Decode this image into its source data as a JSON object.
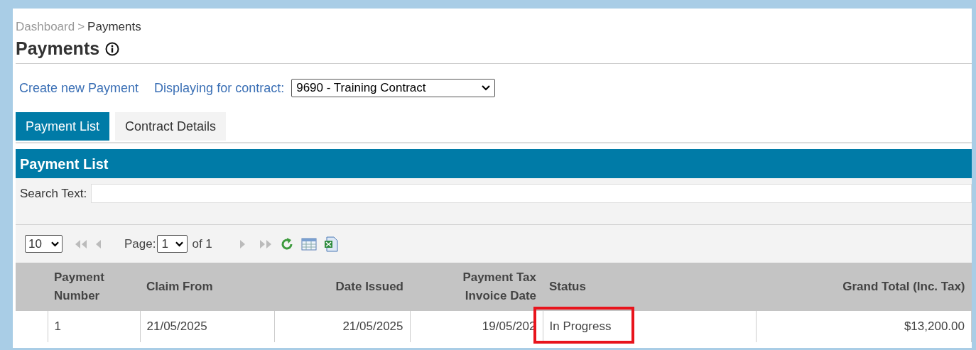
{
  "breadcrumb": [
    {
      "label": "Dashboard",
      "current": false
    },
    {
      "label": "Payments",
      "current": true
    }
  ],
  "breadcrumb_separator": ">",
  "page_title": "Payments",
  "actions": {
    "create_link": "Create new Payment",
    "contract_label": "Displaying for contract:",
    "contract_value": "9690 - Training Contract"
  },
  "tabs": [
    {
      "label": "Payment List",
      "selected": true
    },
    {
      "label": "Contract Details",
      "selected": false
    }
  ],
  "panel": {
    "title": "Payment List",
    "search_label": "Search Text:"
  },
  "pager": {
    "page_size": "10",
    "page_label": "Page:",
    "page": "1",
    "of_label": "of 1"
  },
  "table": {
    "columns": [
      "Payment Number",
      "Claim From",
      "Date Issued",
      "Payment Tax Invoice Date",
      "Status",
      "Grand Total (Inc. Tax)"
    ],
    "rows": [
      {
        "cells": [
          {
            "text": "1",
            "highlighted": false
          },
          {
            "text": "21/05/2025",
            "highlighted": false
          },
          {
            "text": "21/05/2025",
            "highlighted": false
          },
          {
            "text": "19/05/202",
            "highlighted": false
          },
          {
            "text": "In Progress",
            "highlighted": true
          },
          {
            "text": "$13,200.00",
            "highlighted": false
          }
        ]
      }
    ]
  }
}
